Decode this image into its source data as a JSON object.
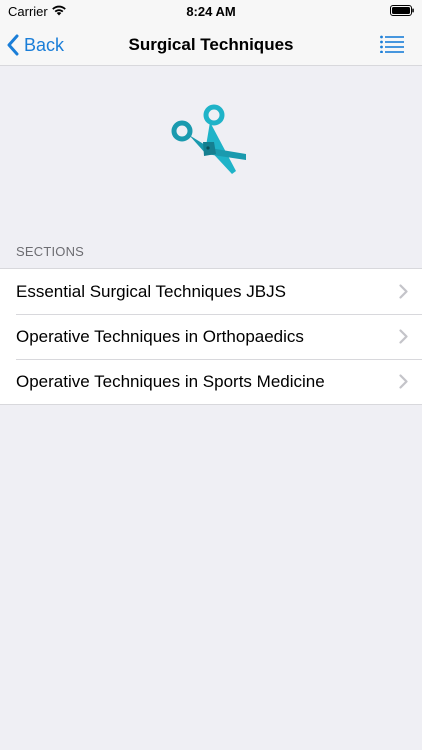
{
  "status_bar": {
    "carrier": "Carrier",
    "time": "8:24 AM"
  },
  "nav": {
    "back_label": "Back",
    "title": "Surgical Techniques",
    "accent_color": "#1a7ed8"
  },
  "hero": {
    "icon": "scissors-icon",
    "icon_color": "#1fb3c8"
  },
  "sections": {
    "header": "SECTIONS",
    "items": [
      {
        "label": "Essential Surgical Techniques JBJS"
      },
      {
        "label": "Operative Techniques in Orthopaedics"
      },
      {
        "label": "Operative Techniques in Sports Medicine"
      }
    ]
  }
}
